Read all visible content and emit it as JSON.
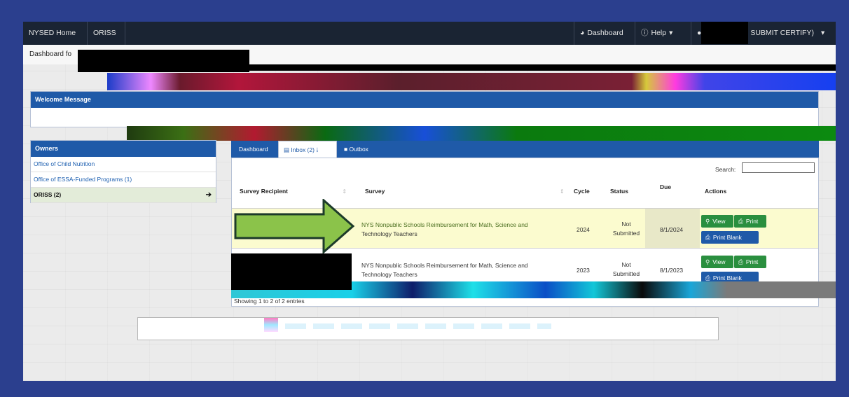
{
  "nav": {
    "home": "NYSED Home",
    "app": "ORISS",
    "dashboard": "Dashboard",
    "help": "Help",
    "user_role_suffix": "SUBMIT CERTIFY)"
  },
  "breadcrumb": {
    "text": "Dashboard fo"
  },
  "welcome": {
    "title": "Welcome Message"
  },
  "owners": {
    "title": "Owners",
    "items": [
      {
        "label": "Office of Child Nutrition"
      },
      {
        "label": "Office of ESSA-Funded Programs (1)"
      },
      {
        "label": "ORISS (2)"
      }
    ]
  },
  "tabs": {
    "dashboard": "Dashboard",
    "inbox": "Inbox (2)",
    "outbox": "Outbox"
  },
  "search": {
    "label": "Search:"
  },
  "table": {
    "headers": {
      "recipient": "Survey Recipient",
      "survey": "Survey",
      "cycle": "Cycle",
      "status": "Status",
      "due": "Due",
      "actions": "Actions"
    },
    "rows": [
      {
        "survey_line1": "NYS Nonpublic Schools Reimbursement for Math, Science and",
        "survey_line2": "Technology Teachers",
        "cycle": "2024",
        "status_line1": "Not",
        "status_line2": "Submitted",
        "due": "8/1/2024"
      },
      {
        "survey_line1": "NYS Nonpublic Schools Reimbursement for Math, Science and",
        "survey_line2": "Technology Teachers",
        "cycle": "2023",
        "status_line1": "Not",
        "status_line2": "Submitted",
        "due": "8/1/2023"
      }
    ],
    "footer": "Showing 1 to 2 of 2 entries"
  },
  "buttons": {
    "view": "View",
    "print": "Print",
    "print_blank": "Print Blank"
  },
  "colors": {
    "navbar": "#1a2433",
    "panel_header": "#1f5aa8",
    "highlight_row": "#fbfbcf",
    "arrow": "#8bc34a",
    "frame": "#2b3f8e"
  }
}
